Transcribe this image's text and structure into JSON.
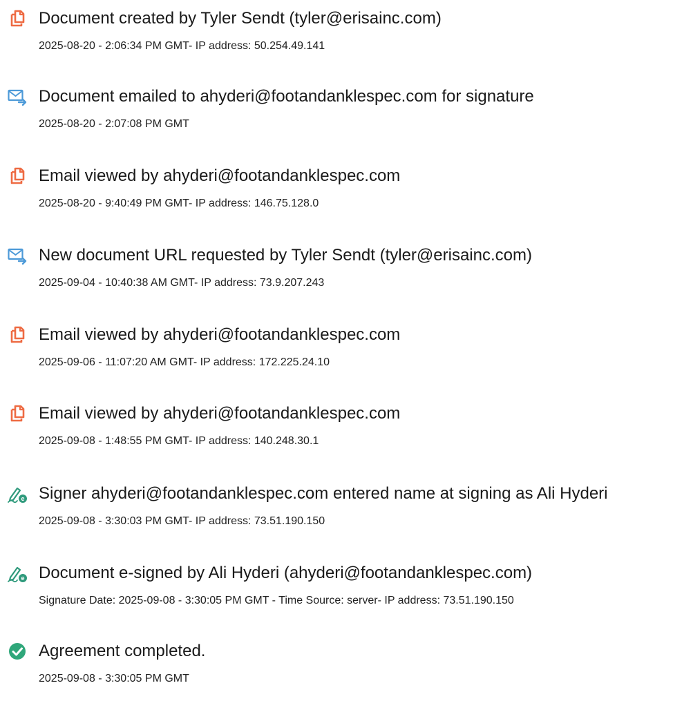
{
  "colors": {
    "doc_icon": "#ee6b43",
    "email_icon": "#4d9ad8",
    "sign_icon": "#2f9a7c",
    "check_icon": "#2fa77a"
  },
  "entries": [
    {
      "icon": "document-icon",
      "title": "Document created by Tyler Sendt (tyler@erisainc.com)",
      "detail": "2025-08-20 - 2:06:34 PM GMT- IP address: 50.254.49.141"
    },
    {
      "icon": "email-icon",
      "title": "Document emailed to ahyderi@footandanklespec.com for signature",
      "detail": "2025-08-20 - 2:07:08 PM GMT"
    },
    {
      "icon": "document-icon",
      "title": "Email viewed by ahyderi@footandanklespec.com",
      "detail": "2025-08-20 - 9:40:49 PM GMT- IP address: 146.75.128.0"
    },
    {
      "icon": "email-icon",
      "title": "New document URL requested by Tyler Sendt (tyler@erisainc.com)",
      "detail": "2025-09-04 - 10:40:38 AM GMT- IP address: 73.9.207.243"
    },
    {
      "icon": "document-icon",
      "title": "Email viewed by ahyderi@footandanklespec.com",
      "detail": "2025-09-06 - 11:07:20 AM GMT- IP address: 172.225.24.10"
    },
    {
      "icon": "document-icon",
      "title": "Email viewed by ahyderi@footandanklespec.com",
      "detail": "2025-09-08 - 1:48:55 PM GMT- IP address: 140.248.30.1"
    },
    {
      "icon": "signature-pen-icon",
      "title": "Signer ahyderi@footandanklespec.com entered name at signing as Ali Hyderi",
      "detail": "2025-09-08 - 3:30:03 PM GMT- IP address: 73.51.190.150"
    },
    {
      "icon": "signature-pen-icon",
      "title": "Document e-signed by Ali Hyderi (ahyderi@footandanklespec.com)",
      "detail": "Signature Date: 2025-09-08 - 3:30:05 PM GMT - Time Source: server- IP address: 73.51.190.150"
    },
    {
      "icon": "check-circle-icon",
      "title": "Agreement completed.",
      "detail": "2025-09-08 - 3:30:05 PM GMT"
    }
  ]
}
